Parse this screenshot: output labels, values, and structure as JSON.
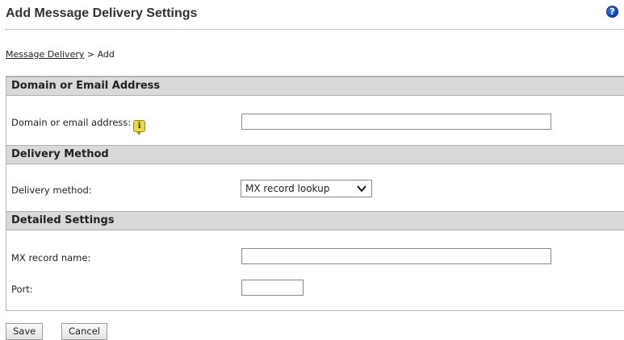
{
  "page": {
    "title": "Add Message Delivery Settings",
    "help_icon": "question-circle-icon"
  },
  "breadcrumb": {
    "link": "Message Delivery",
    "separator": " > ",
    "current": "Add"
  },
  "sections": {
    "domain": {
      "header": "Domain or Email Address",
      "label": "Domain or email address:",
      "info_icon": "info-tooltip-icon",
      "value": ""
    },
    "delivery": {
      "header": "Delivery Method",
      "label": "Delivery method:",
      "selected": "MX record lookup"
    },
    "detailed": {
      "header": "Detailed Settings",
      "mx_label": "MX record name:",
      "mx_value": "",
      "port_label": "Port:",
      "port_value": ""
    }
  },
  "buttons": {
    "save": "Save",
    "cancel": "Cancel"
  }
}
